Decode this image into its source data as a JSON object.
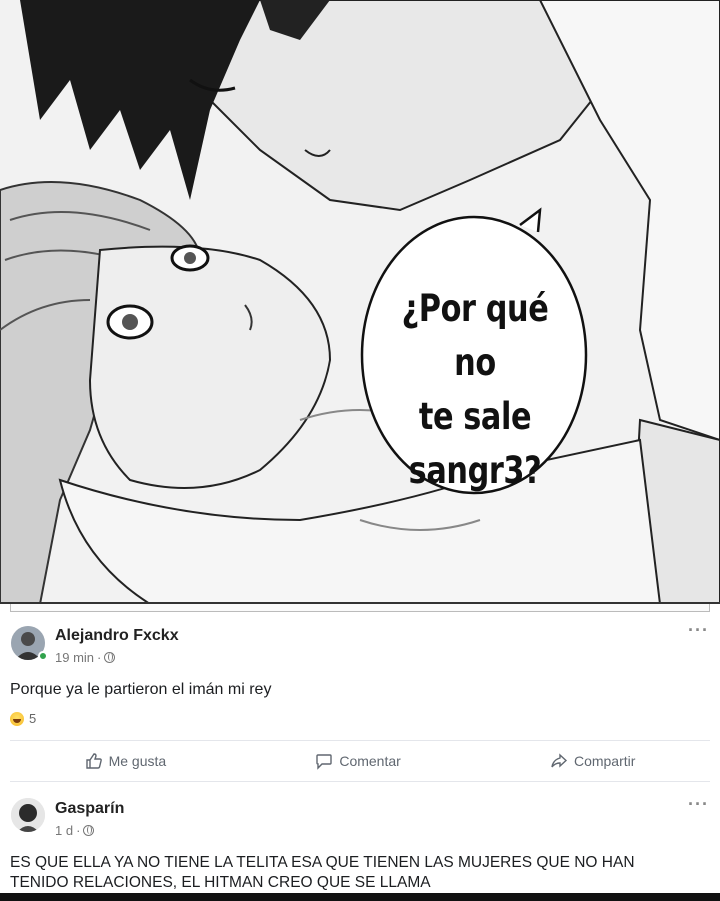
{
  "bubble": {
    "line1": "¿Por qué no",
    "line2": "te sale",
    "line3": "sangr3?"
  },
  "comments": [
    {
      "author": "Alejandro Fxckx",
      "time": "19 min",
      "text": "Porque ya le partieron el imán mi rey",
      "reaction_count": "5",
      "more": "···"
    },
    {
      "author": "Gasparín",
      "time": "1 d",
      "text_line1": "ES QUE ELLA YA NO TIENE LA TELITA ESA QUE TIENEN LAS MUJERES QUE NO HAN",
      "text_line2": "TENIDO RELACIONES, EL HITMAN CREO QUE SE LLAMA",
      "more": "···"
    }
  ],
  "actions": {
    "like": "Me gusta",
    "comment": "Comentar",
    "share": "Compartir"
  },
  "colors": {
    "online": "#31a24c",
    "action_text": "#606770"
  }
}
